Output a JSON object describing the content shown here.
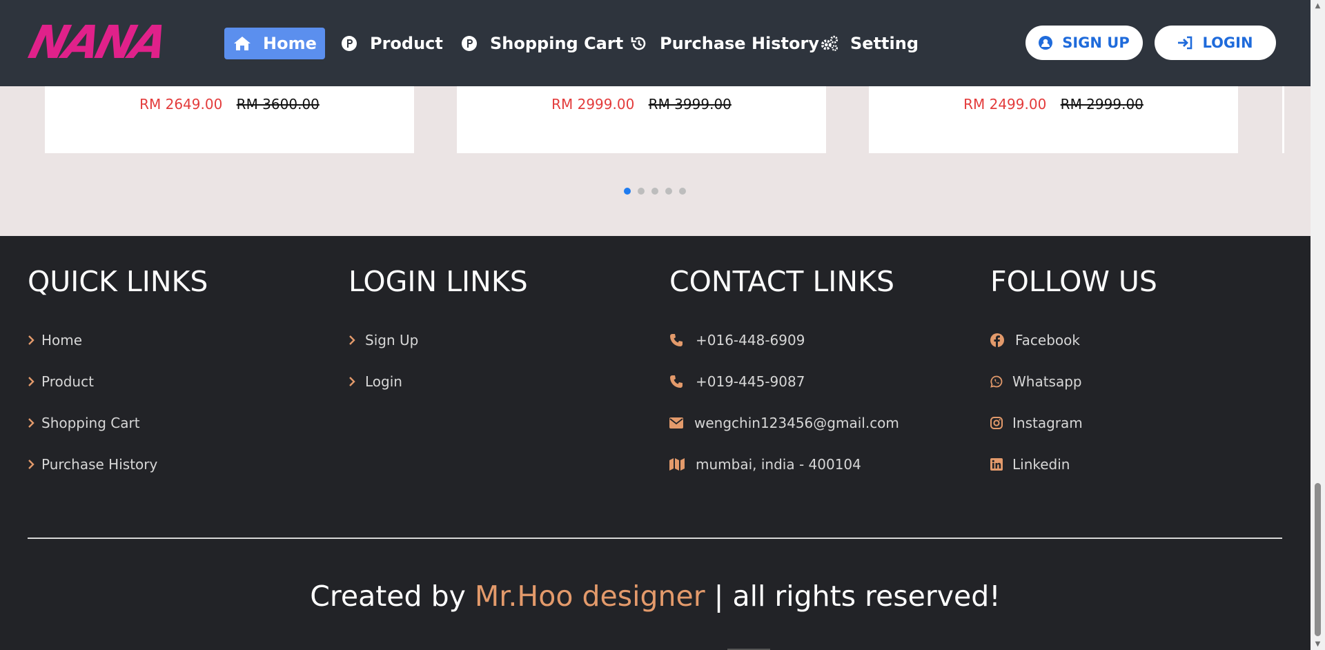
{
  "brand": {
    "logo_text": "NANA",
    "accent_color": "#e0218a"
  },
  "nav": {
    "items": [
      {
        "label": "Home",
        "icon": "home-icon",
        "active": true
      },
      {
        "label": "Product",
        "icon": "p-circle-icon"
      },
      {
        "label": "Shopping Cart",
        "icon": "p-circle-icon"
      },
      {
        "label": "Purchase History",
        "icon": "history-icon"
      },
      {
        "label": "Setting",
        "icon": "gears-icon"
      }
    ],
    "signup_label": "SIGN UP",
    "login_label": "LOGIN"
  },
  "products": [
    {
      "price": "RM 2649.00",
      "old_price": "RM 3600.00"
    },
    {
      "price": "RM 2999.00",
      "old_price": "RM 3999.00"
    },
    {
      "price": "RM 2499.00",
      "old_price": "RM 2999.00"
    }
  ],
  "carousel": {
    "total": 5,
    "active_index": 0
  },
  "footer": {
    "quick": {
      "heading": "QUICK LINKS",
      "items": [
        "Home",
        "Product",
        "Shopping Cart",
        "Purchase History"
      ]
    },
    "login": {
      "heading": "LOGIN LINKS",
      "items": [
        "Sign Up",
        "Login"
      ]
    },
    "contact": {
      "heading": "CONTACT LINKS",
      "items": [
        "+016-448-6909",
        "+019-445-9087",
        "wengchin123456@gmail.com",
        "mumbai, india - 400104"
      ]
    },
    "follow": {
      "heading": "FOLLOW US",
      "items": [
        "Facebook",
        "Whatsapp",
        "Instagram",
        "Linkedin"
      ]
    },
    "credit": {
      "prefix": "Created by",
      "author": "Mr.Hoo designer",
      "suffix": "| all rights reserved!"
    },
    "icon_color": "#e39a6b"
  }
}
